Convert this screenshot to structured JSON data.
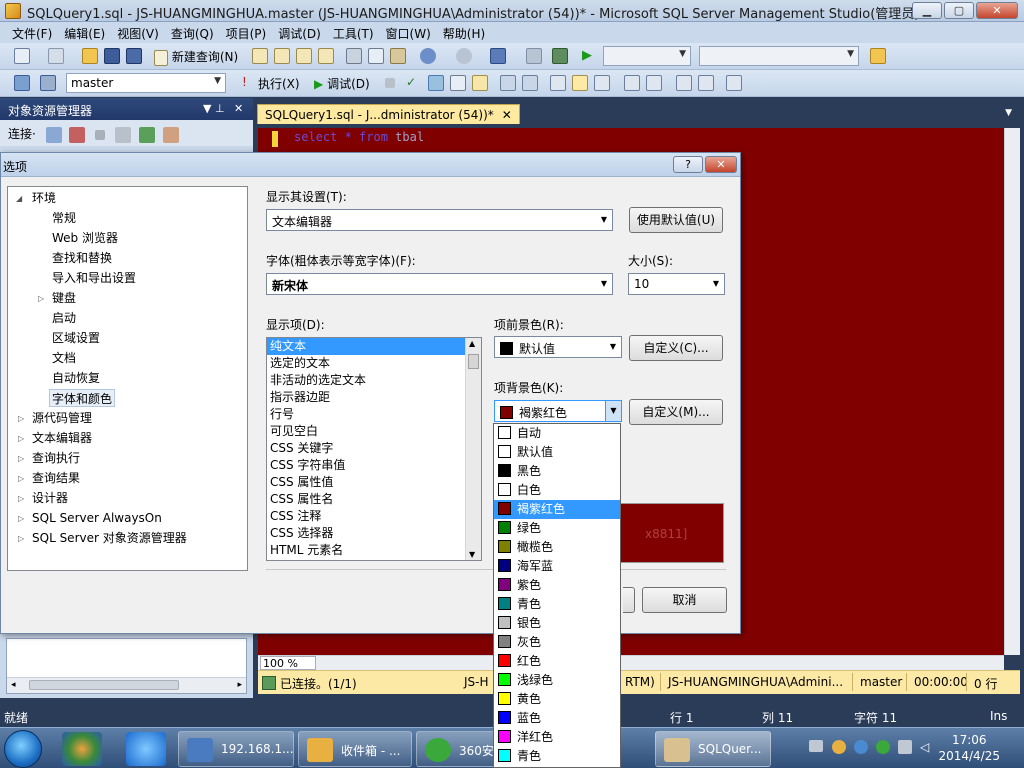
{
  "window": {
    "title": "SQLQuery1.sql - JS-HUANGMINGHUA.master (JS-HUANGMINGHUA\\Administrator (54))* - Microsoft SQL Server Management Studio(管理员)",
    "min": "▁",
    "max": "▢",
    "close": "✕"
  },
  "menu": [
    "文件(F)",
    "编辑(E)",
    "视图(V)",
    "查询(Q)",
    "项目(P)",
    "调试(D)",
    "工具(T)",
    "窗口(W)",
    "帮助(H)"
  ],
  "toolbar1": {
    "new_query": "新建查询(N)"
  },
  "toolbar2": {
    "database": "master",
    "execute": "执行(X)",
    "debug": "调试(D)"
  },
  "object_explorer": {
    "title": "对象资源管理器",
    "connect": "连接·",
    "pin": "▼ ⊥",
    "close": "✕"
  },
  "editor": {
    "tab_label": "SQLQuery1.sql - J...dministrator (54))*",
    "tab_close": "✕",
    "code_keyword": "select * from",
    "code_table": "tbal",
    "zoom": "100 %"
  },
  "query_status": {
    "connected": "已连接。(1/1)",
    "server_fragment": "JS-H",
    "version_fragment": "RTM)",
    "user": "JS-HUANGMINGHUA\\Admini...",
    "database": "master",
    "time": "00:00:00",
    "rows": "0 行"
  },
  "app_status": {
    "ready": "就绪",
    "line": "行 1",
    "col": "列 11",
    "char": "字符 11",
    "mode": "Ins"
  },
  "taskbar": {
    "tasks": [
      "192.168.1...",
      "收件箱 - ...",
      "360安",
      "SQLQuer..."
    ],
    "time": "17:06",
    "date": "2014/4/25"
  },
  "dialog": {
    "title": "选项",
    "help": "?",
    "close": "✕",
    "tree": {
      "env": "环境",
      "env_children": [
        "常规",
        "Web 浏览器",
        "查找和替换",
        "导入和导出设置",
        "键盘",
        "启动",
        "区域设置",
        "文档",
        "自动恢复",
        "字体和颜色"
      ],
      "others": [
        "源代码管理",
        "文本编辑器",
        "查询执行",
        "查询结果",
        "设计器",
        "SQL Server AlwaysOn",
        "SQL Server 对象资源管理器"
      ]
    },
    "show_settings_label": "显示其设置(T):",
    "show_settings_value": "文本编辑器",
    "use_defaults": "使用默认值(U)",
    "font_label": "字体(粗体表示等宽字体)(F):",
    "font_value": "新宋体",
    "size_label": "大小(S):",
    "size_value": "10",
    "display_items_label": "显示项(D):",
    "display_items": [
      "纯文本",
      "选定的文本",
      "非活动的选定文本",
      "指示器边距",
      "行号",
      "可见空白",
      "CSS 关键字",
      "CSS 字符串值",
      "CSS 属性值",
      "CSS 属性名",
      "CSS 注释",
      "CSS 选择器",
      "HTML 元素名"
    ],
    "fg_label": "项前景色(R):",
    "fg_value": "默认值",
    "fg_custom": "自定义(C)...",
    "bg_label": "项背景色(K):",
    "bg_value": "褐紫红色",
    "bg_custom": "自定义(M)...",
    "sample_text": "x8811]",
    "cancel": "取消",
    "color_options": [
      {
        "name": "自动",
        "color": "#ffffff"
      },
      {
        "name": "默认值",
        "color": "#ffffff"
      },
      {
        "name": "黑色",
        "color": "#000000"
      },
      {
        "name": "白色",
        "color": "#ffffff"
      },
      {
        "name": "褐紫红色",
        "color": "#800000"
      },
      {
        "name": "绿色",
        "color": "#008000"
      },
      {
        "name": "橄榄色",
        "color": "#808000"
      },
      {
        "name": "海军蓝",
        "color": "#000080"
      },
      {
        "name": "紫色",
        "color": "#800080"
      },
      {
        "name": "青色",
        "color": "#008080"
      },
      {
        "name": "银色",
        "color": "#c0c0c0"
      },
      {
        "name": "灰色",
        "color": "#808080"
      },
      {
        "name": "红色",
        "color": "#ff0000"
      },
      {
        "name": "浅绿色",
        "color": "#00ff00"
      },
      {
        "name": "黄色",
        "color": "#ffff00"
      },
      {
        "name": "蓝色",
        "color": "#0000ff"
      },
      {
        "name": "洋红色",
        "color": "#ff00ff"
      },
      {
        "name": "青色",
        "color": "#00ffff"
      }
    ],
    "selected_color": "褐紫红色"
  }
}
